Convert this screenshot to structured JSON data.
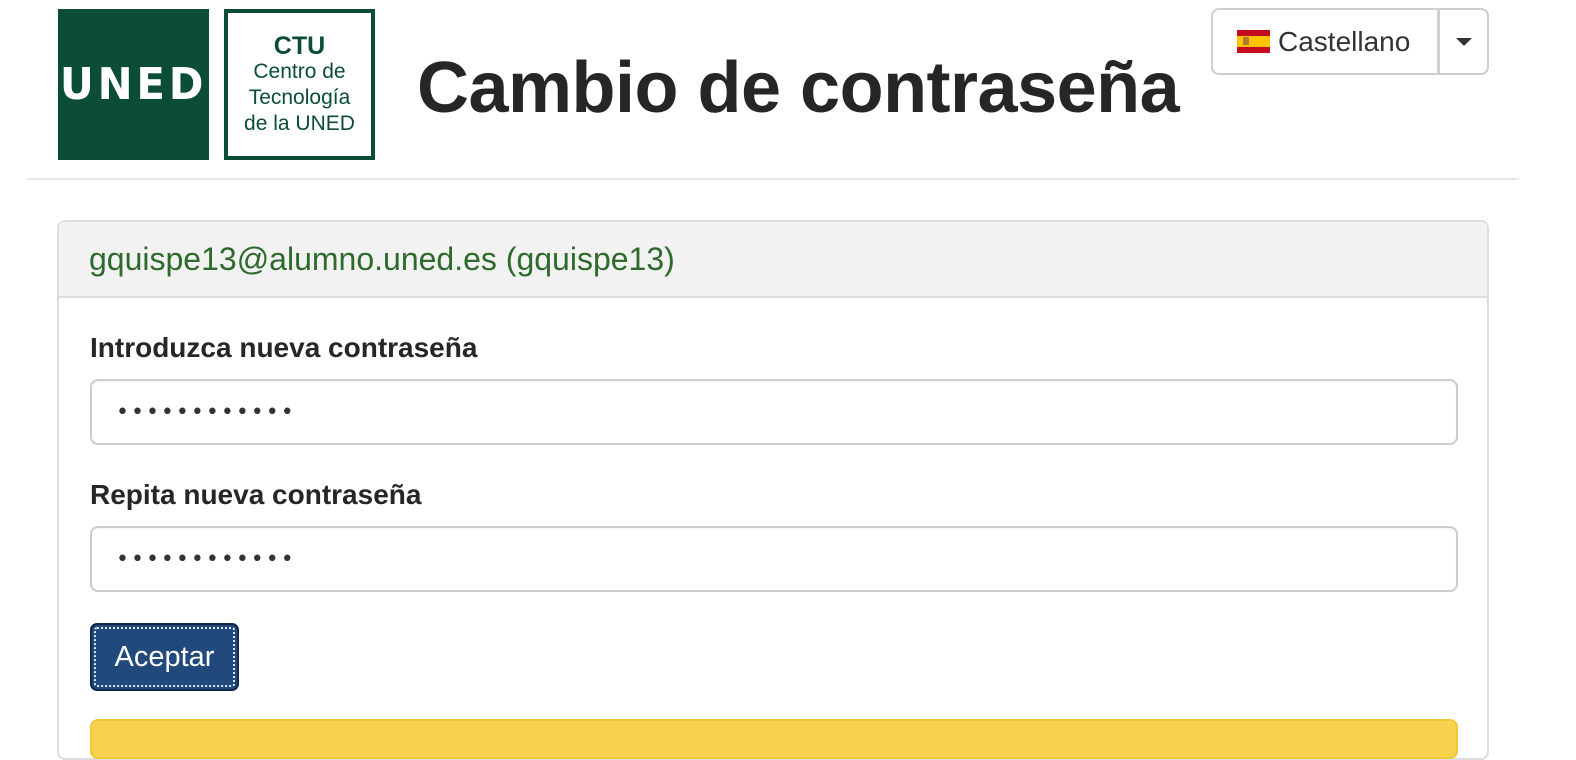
{
  "header": {
    "logo_uned_text": "UNED",
    "logo_ctu": {
      "line1": "CTU",
      "line2": "Centro de",
      "line3": "Tecnología",
      "line4": "de la UNED"
    },
    "title": "Cambio de contraseña",
    "language": {
      "selected": "Castellano",
      "flag_icon": "spain-flag-icon",
      "toggle_icon": "caret-down-icon"
    }
  },
  "form": {
    "account": "gquispe13@alumno.uned.es (gquispe13)",
    "new_password_label": "Introduzca nueva contraseña",
    "new_password_value": "••••••••••••",
    "repeat_password_label": "Repita nueva contraseña",
    "repeat_password_value": "••••••••••••",
    "submit_label": "Aceptar"
  },
  "colors": {
    "brand_green": "#0b4d35",
    "account_green": "#2e6a2b",
    "button_blue": "#21497c",
    "alert_yellow": "#f7d24e"
  }
}
